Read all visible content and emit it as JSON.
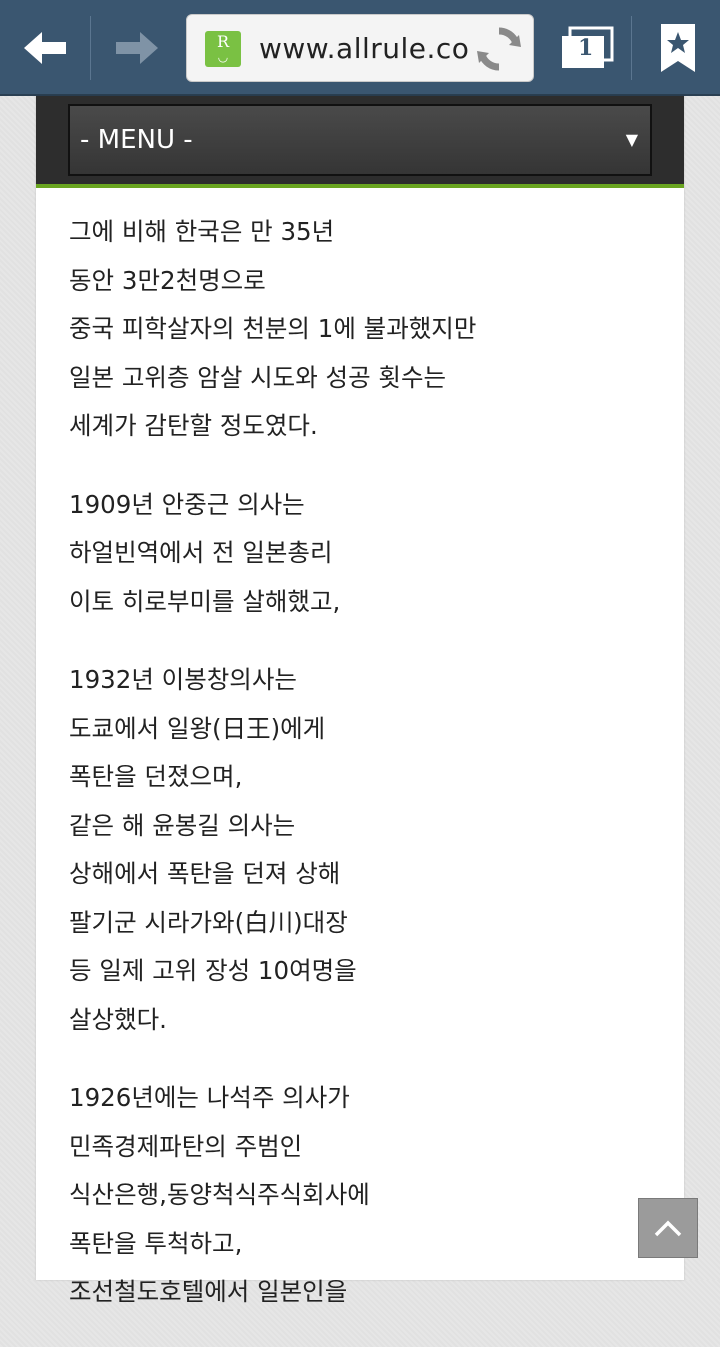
{
  "browser": {
    "url": "www.allrule.co",
    "favicon_letter": "R",
    "tab_count": "1"
  },
  "page": {
    "menu_label": "- MENU -",
    "menu_arrow": "▼",
    "paragraphs": [
      [
        "그에 비해 한국은 만 35년",
        "동안 3만2천명으로",
        "중국 피학살자의 천분의 1에 불과했지만",
        "일본 고위층 암살 시도와 성공 횟수는",
        "세계가 감탄할 정도였다."
      ],
      [
        "1909년 안중근 의사는",
        "하얼빈역에서 전 일본총리",
        "이토 히로부미를 살해했고,"
      ],
      [
        "1932년 이봉창의사는",
        "도쿄에서 일왕(日王)에게",
        "폭탄을 던졌으며,",
        "같은 해 윤봉길 의사는",
        "상해에서 폭탄을 던져 상해",
        "팔기군 시라가와(白川)대장",
        "등 일제 고위 장성 10여명을",
        "살상했다."
      ],
      [
        "1926년에는 나석주 의사가",
        "민족경제파탄의 주범인",
        "식산은행,동양척식주식회사에",
        "폭탄을 투척하고,",
        "조선철도호텔에서 일본인을"
      ]
    ]
  }
}
